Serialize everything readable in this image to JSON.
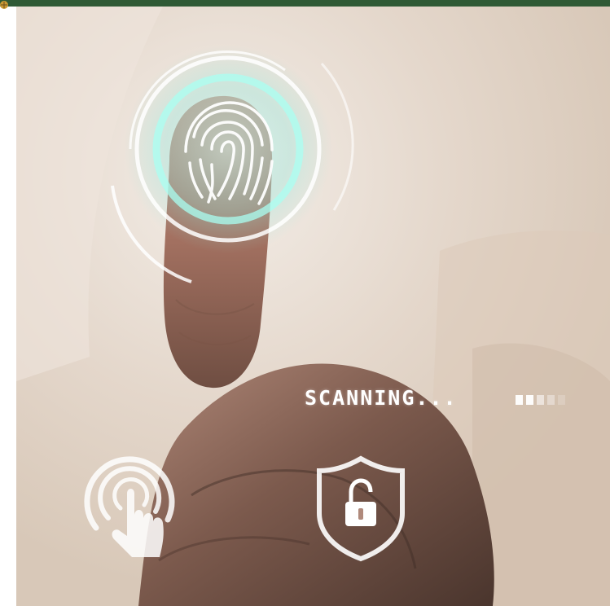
{
  "status": {
    "label": "SCANNING..."
  },
  "progress": {
    "filled_segments": 2,
    "total_segments": 5
  },
  "icons": {
    "fingerprint": "fingerprint-icon",
    "touch": "tap-hand-icon",
    "security": "shield-unlock-icon"
  },
  "colors": {
    "header_bar": "#2f5a35",
    "scan_glow": "#9ff2e6",
    "ui_white": "#ffffff"
  }
}
